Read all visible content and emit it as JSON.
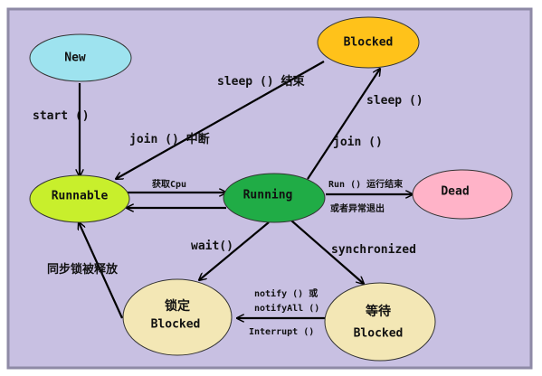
{
  "colors": {
    "background": "#c8c0e2",
    "border": "#8e8aa6",
    "new": "#9ee3ef",
    "blocked_top": "#ffc21a",
    "runnable": "#c8ef2c",
    "running": "#20ac46",
    "dead": "#ffb3c8",
    "lock_blocked": "#f3e7b5",
    "wait_blocked": "#f3e7b5",
    "arrow": "#000000"
  },
  "states": {
    "new": {
      "label": "New"
    },
    "blocked_top": {
      "label": "Blocked"
    },
    "runnable": {
      "label": "Runnable"
    },
    "running": {
      "label": "Running"
    },
    "dead": {
      "label": "Dead"
    },
    "lock_blocked": {
      "line1": "锁定",
      "line2": "Blocked"
    },
    "wait_blocked": {
      "line1": "等待",
      "line2": "Blocked"
    }
  },
  "transitions": {
    "start": "start ()",
    "sleep_end": "sleep () 结束",
    "join_interrupt": "join () 中断",
    "sleep": "sleep ()",
    "join": "join ()",
    "get_cpu": "获取Cpu",
    "run_end_1": "Run () 运行结束",
    "run_end_2": "或者异常退出",
    "wait": "wait()",
    "synchronized": "synchronized",
    "lock_released": "同步锁被释放",
    "notify_1": "notify () 或",
    "notify_2": "notifyAll ()",
    "interrupt": "Interrupt ()"
  }
}
